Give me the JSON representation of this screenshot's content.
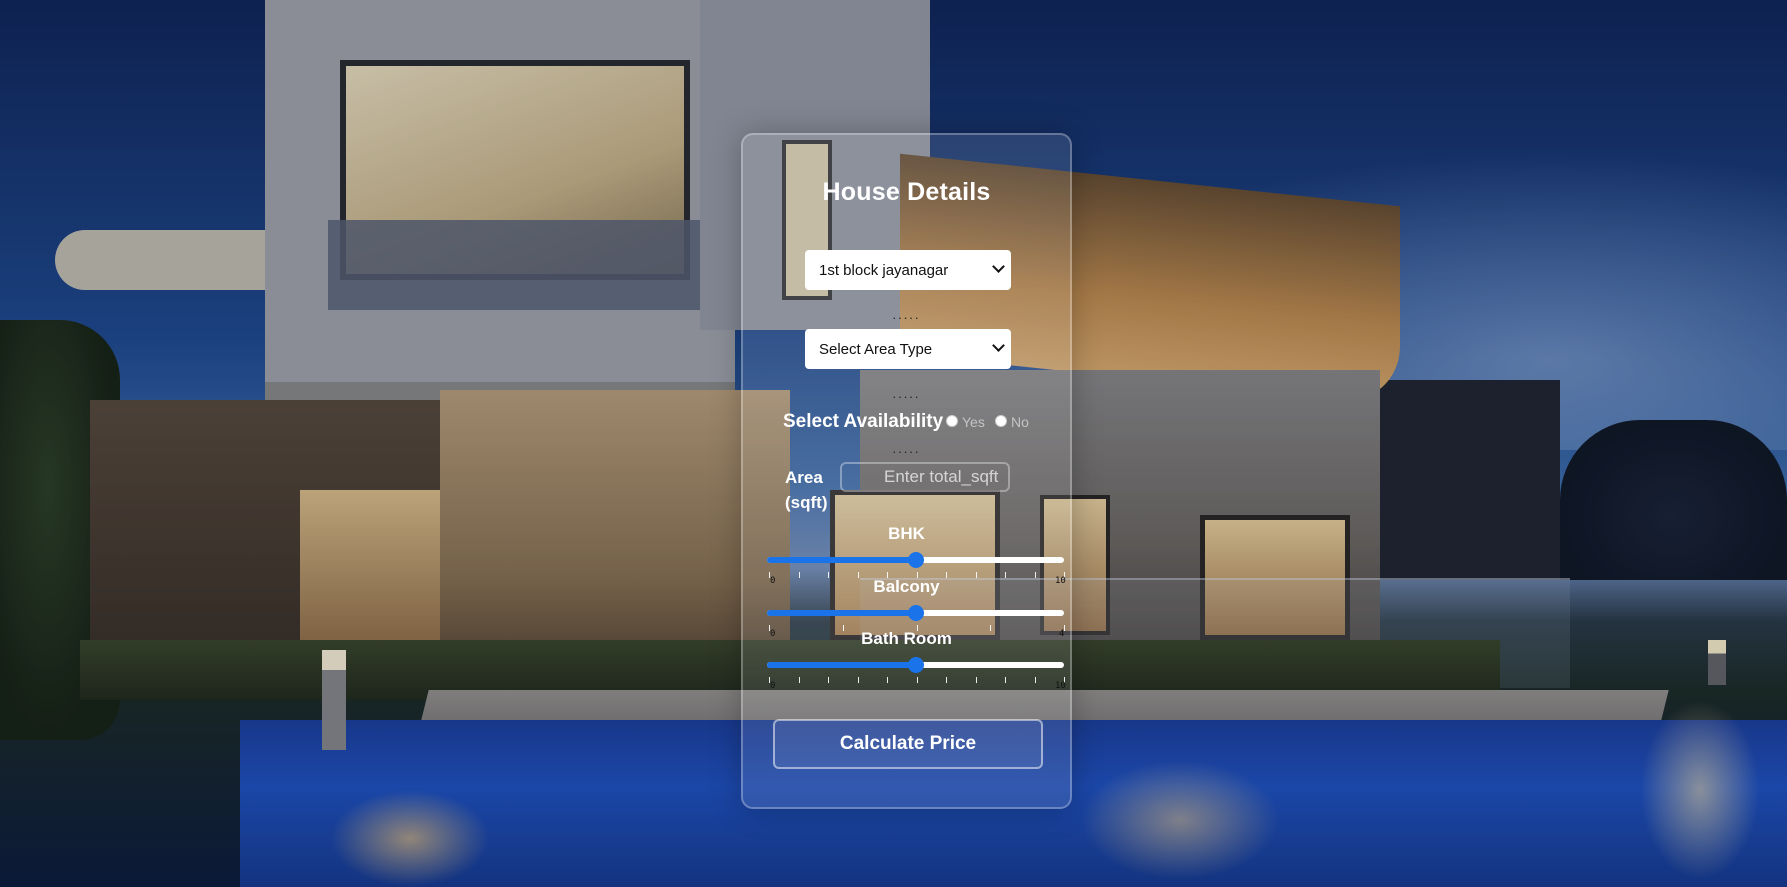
{
  "form": {
    "title": "House Details",
    "location_select": {
      "selected": "1st block jayanagar"
    },
    "area_type_select": {
      "selected": "Select Area Type"
    },
    "availability": {
      "label": "Select Availability",
      "options": [
        "Yes",
        "No"
      ]
    },
    "area": {
      "label": "Area (sqft)",
      "placeholder": "Enter total_sqft"
    },
    "sliders": [
      {
        "label": "BHK",
        "min": 0,
        "max": 10,
        "value": 5,
        "min_label": "0",
        "max_label": "10"
      },
      {
        "label": "Balcony",
        "min": 0,
        "max": 4,
        "value": 2,
        "min_label": "0",
        "max_label": "4"
      },
      {
        "label": "Bath Room",
        "min": 0,
        "max": 10,
        "value": 5,
        "min_label": "0",
        "max_label": "10"
      }
    ],
    "submit_label": "Calculate Price",
    "colors": {
      "slider_accent": "#1a73e8",
      "text": "#ffffff"
    }
  }
}
